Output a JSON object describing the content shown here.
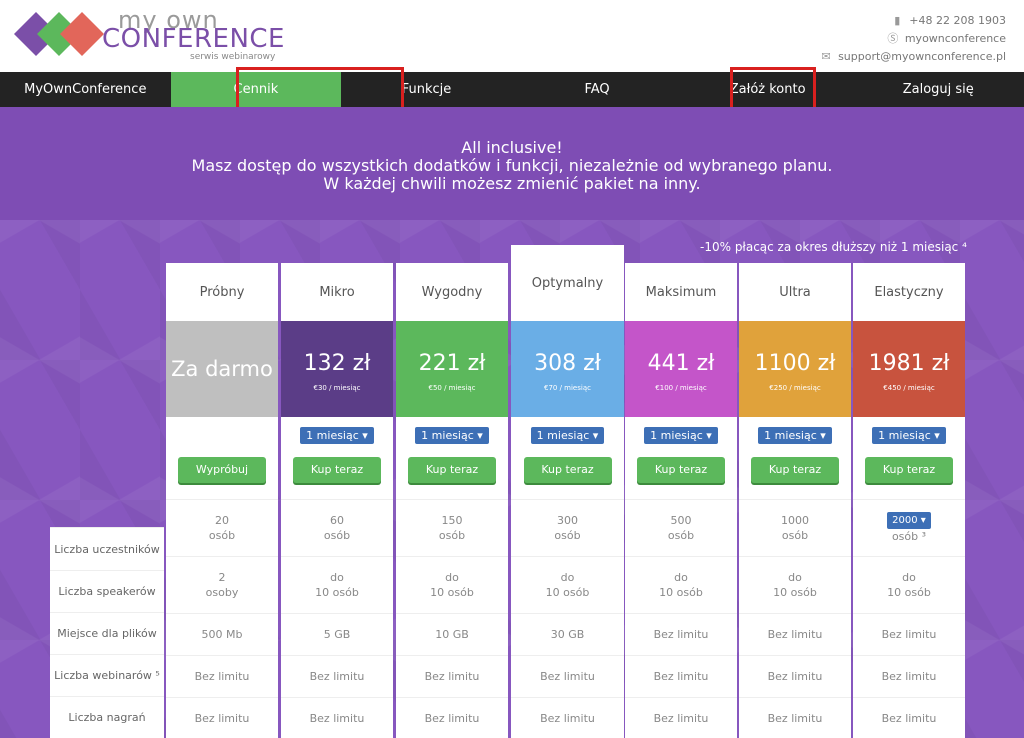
{
  "header": {
    "logo_line1": "my own",
    "logo_line2": "CONFERENCE",
    "logo_line3": "serwis webinarowy",
    "phone": "+48 22 208 1903",
    "skype": "myownconference",
    "email": "support@myownconference.pl",
    "phone_icon": "phone-icon",
    "skype_icon": "skype-icon",
    "email_icon": "envelope-icon"
  },
  "nav": [
    {
      "label": "MyOwnConference"
    },
    {
      "label": "Cennik"
    },
    {
      "label": "Funkcje"
    },
    {
      "label": "FAQ"
    },
    {
      "label": "Załóż konto"
    },
    {
      "label": "Zaloguj się"
    }
  ],
  "banner": {
    "line1": "All inclusive!",
    "line2": "Masz dostęp do wszystkich dodatków i funkcji, niezależnie od wybranego planu.",
    "line3": "W każdej chwili możesz zmienić pakiet na inny."
  },
  "discount_note": "-10% płacąc za okres dłuższy niż 1 miesiąc ⁴",
  "row_labels": [
    "Liczba uczestników",
    "Liczba speakerów",
    "Miejsce dla plików",
    "Liczba webinarów ⁵",
    "Liczba nagrań"
  ],
  "plans": [
    {
      "name": "Próbny",
      "price": "Za darmo",
      "sub": "",
      "dropdown": "",
      "button": "Wypróbuj",
      "participants": "20\nosób",
      "speakers": "2\nosoby",
      "storage": "500 Mb",
      "webinars": "Bez limitu",
      "recordings": "Bez limitu",
      "color": "#bfbfbf"
    },
    {
      "name": "Mikro",
      "price": "132 zł",
      "sub": "€30 / miesiąc",
      "dropdown": "1 miesiąc ▾",
      "button": "Kup teraz",
      "participants": "60\nosób",
      "speakers": "do\n10 osób",
      "storage": "5 GB",
      "webinars": "Bez limitu",
      "recordings": "Bez limitu",
      "color": "#5b3d87"
    },
    {
      "name": "Wygodny",
      "price": "221 zł",
      "sub": "€50 / miesiąc",
      "dropdown": "1 miesiąc ▾",
      "button": "Kup teraz",
      "participants": "150\nosób",
      "speakers": "do\n10 osób",
      "storage": "10 GB",
      "webinars": "Bez limitu",
      "recordings": "Bez limitu",
      "color": "#5cb85c"
    },
    {
      "name": "Optymalny",
      "price": "308 zł",
      "sub": "€70 / miesiąc",
      "dropdown": "1 miesiąc ▾",
      "button": "Kup teraz",
      "participants": "300\nosób",
      "speakers": "do\n10 osób",
      "storage": "30 GB",
      "webinars": "Bez limitu",
      "recordings": "Bez limitu",
      "color": "#6aaee6"
    },
    {
      "name": "Maksimum",
      "price": "441 zł",
      "sub": "€100 / miesiąc",
      "dropdown": "1 miesiąc ▾",
      "button": "Kup teraz",
      "participants": "500\nosób",
      "speakers": "do\n10 osób",
      "storage": "Bez limitu",
      "webinars": "Bez limitu",
      "recordings": "Bez limitu",
      "color": "#c455c9"
    },
    {
      "name": "Ultra",
      "price": "1100 zł",
      "sub": "€250 / miesiąc",
      "dropdown": "1 miesiąc ▾",
      "button": "Kup teraz",
      "participants": "1000\nosób",
      "speakers": "do\n10 osób",
      "storage": "Bez limitu",
      "webinars": "Bez limitu",
      "recordings": "Bez limitu",
      "color": "#e0a23b"
    },
    {
      "name": "Elastyczny",
      "price": "1981 zł",
      "sub": "€450 / miesiąc",
      "dropdown": "1 miesiąc ▾",
      "button": "Kup teraz",
      "participants_dd": "2000 ▾",
      "participants": "osób ³",
      "speakers": "do\n10 osób",
      "storage": "Bez limitu",
      "webinars": "Bez limitu",
      "recordings": "Bez limitu",
      "color": "#c8533e"
    }
  ]
}
